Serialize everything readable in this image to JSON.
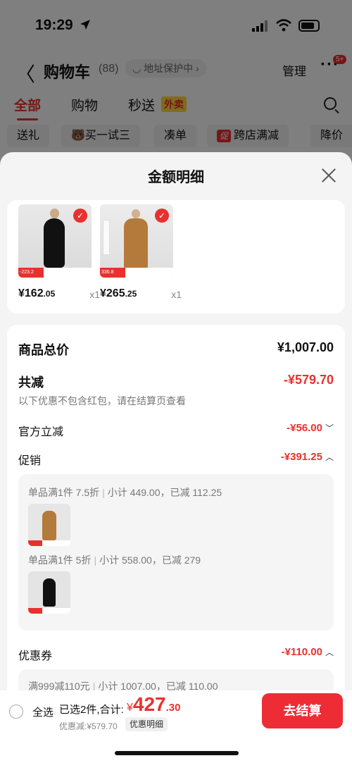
{
  "status": {
    "time": "19:29"
  },
  "header": {
    "back": "〈",
    "title": "购物车",
    "count": "(88)",
    "address": "◡ 地址保护中 ›",
    "manage": "管理",
    "more": "···",
    "badge": "5+"
  },
  "tabs": {
    "all": "全部",
    "shop": "购物",
    "flash": "秒送",
    "flash_tag": "外卖"
  },
  "chips": {
    "gift": "送礼",
    "try": "买一试三",
    "gather": "凑单",
    "cross_tag": "促",
    "cross": "跨店满减",
    "drop": "降价"
  },
  "sheet": {
    "title": "金额明细",
    "products": [
      {
        "price_int": "¥162",
        "price_dec": ".05",
        "qty": "x1",
        "tag": "-223.2"
      },
      {
        "price_int": "¥265",
        "price_dec": ".25",
        "qty": "x1",
        "tag": "336.8"
      }
    ],
    "rows": {
      "goods_total_label": "商品总价",
      "goods_total_value": "¥1,007.00",
      "reduced_label": "共减",
      "reduced_value": "-¥579.70",
      "reduced_note": "以下优惠不包含红包，请在结算页查看",
      "official_label": "官方立减",
      "official_value": "-¥56.00",
      "promo_label": "促销",
      "promo_value": "-¥391.25",
      "coupon_label": "优惠券",
      "coupon_value": "-¥110.00"
    },
    "promo_lines": [
      {
        "rule": "单品满1件 7.5折",
        "detail": "小计 449.00，已减 112.25"
      },
      {
        "rule": "单品满1件 5折",
        "detail": "小计 558.00，已减 279"
      }
    ],
    "coupon_line": {
      "rule": "满999减110元",
      "detail": "小计 1007.00，已减 110.00"
    }
  },
  "bottom": {
    "select_all": "全选",
    "summary": "已选2件,合计:",
    "currency": "¥",
    "total_int": "427",
    "total_dec": ".30",
    "discount": "优惠减:¥579.70",
    "detail_btn": "优惠明细",
    "checkout": "去结算"
  },
  "colors": {
    "accent": "#e8312f",
    "checkout": "#ee2c35",
    "tag_yellow": "#ffd83b"
  }
}
